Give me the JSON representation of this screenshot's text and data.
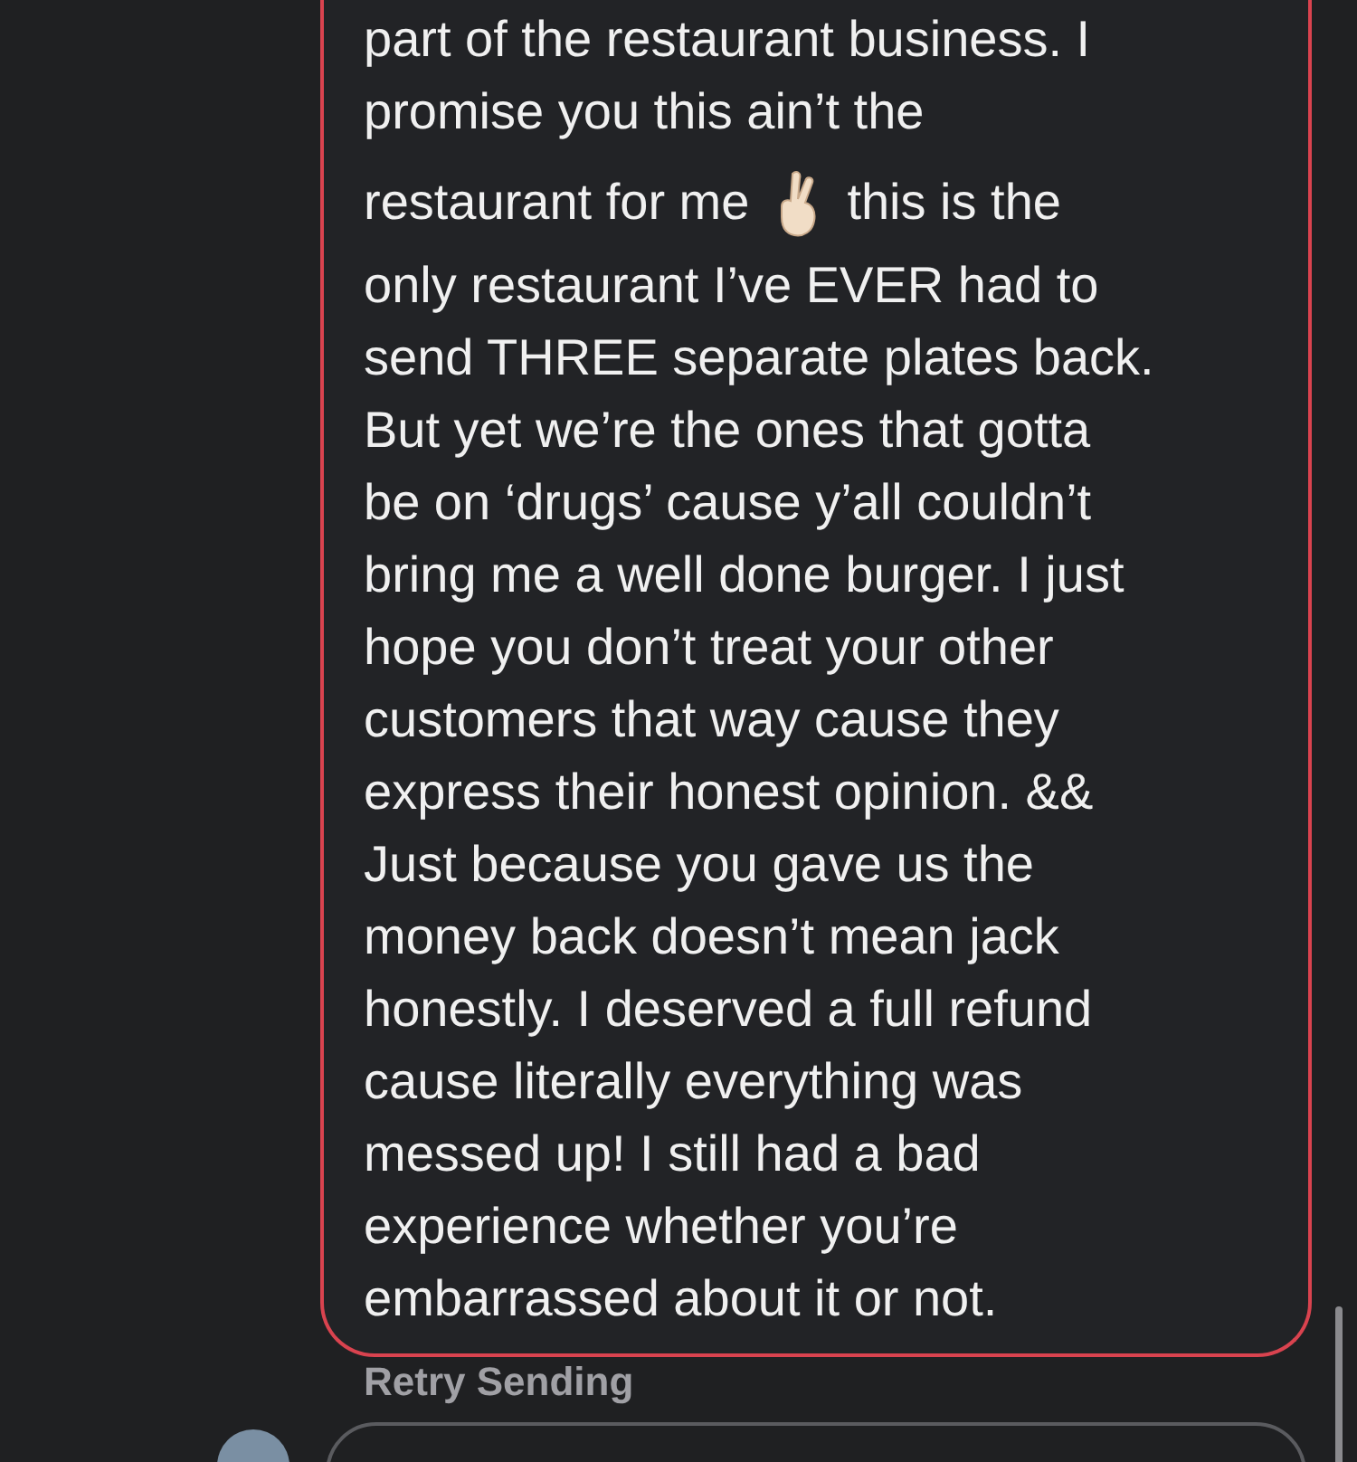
{
  "message": {
    "failed": true,
    "lines": [
      {
        "kind": "text",
        "text": "part of the restaurant business. I"
      },
      {
        "kind": "text",
        "text": "promise you this ain’t the"
      },
      {
        "kind": "emoji",
        "before": "restaurant for me",
        "after": "this is the"
      },
      {
        "kind": "text",
        "text": "only restaurant I’ve EVER had to"
      },
      {
        "kind": "text",
        "text": "send THREE separate plates back."
      },
      {
        "kind": "text",
        "text": "But yet we’re the ones that gotta"
      },
      {
        "kind": "text",
        "text": "be on ‘drugs’ cause y’all couldn’t"
      },
      {
        "kind": "text",
        "text": "bring me a well done burger. I just"
      },
      {
        "kind": "text",
        "text": "hope you don’t treat your other"
      },
      {
        "kind": "text",
        "text": "customers that way cause they"
      },
      {
        "kind": "text",
        "text": "express their honest opinion.  &&"
      },
      {
        "kind": "text",
        "text": "Just because you gave us the"
      },
      {
        "kind": "text",
        "text": "money back doesn’t mean jack"
      },
      {
        "kind": "text",
        "text": "honestly. I deserved a full refund"
      },
      {
        "kind": "text",
        "text": "cause literally everything was"
      },
      {
        "kind": "text",
        "text": "messed up!  I still had a bad"
      },
      {
        "kind": "text",
        "text": "experience whether you’re"
      },
      {
        "kind": "text",
        "text": "embarrassed about it or not."
      }
    ]
  },
  "status": "Retry Sending"
}
